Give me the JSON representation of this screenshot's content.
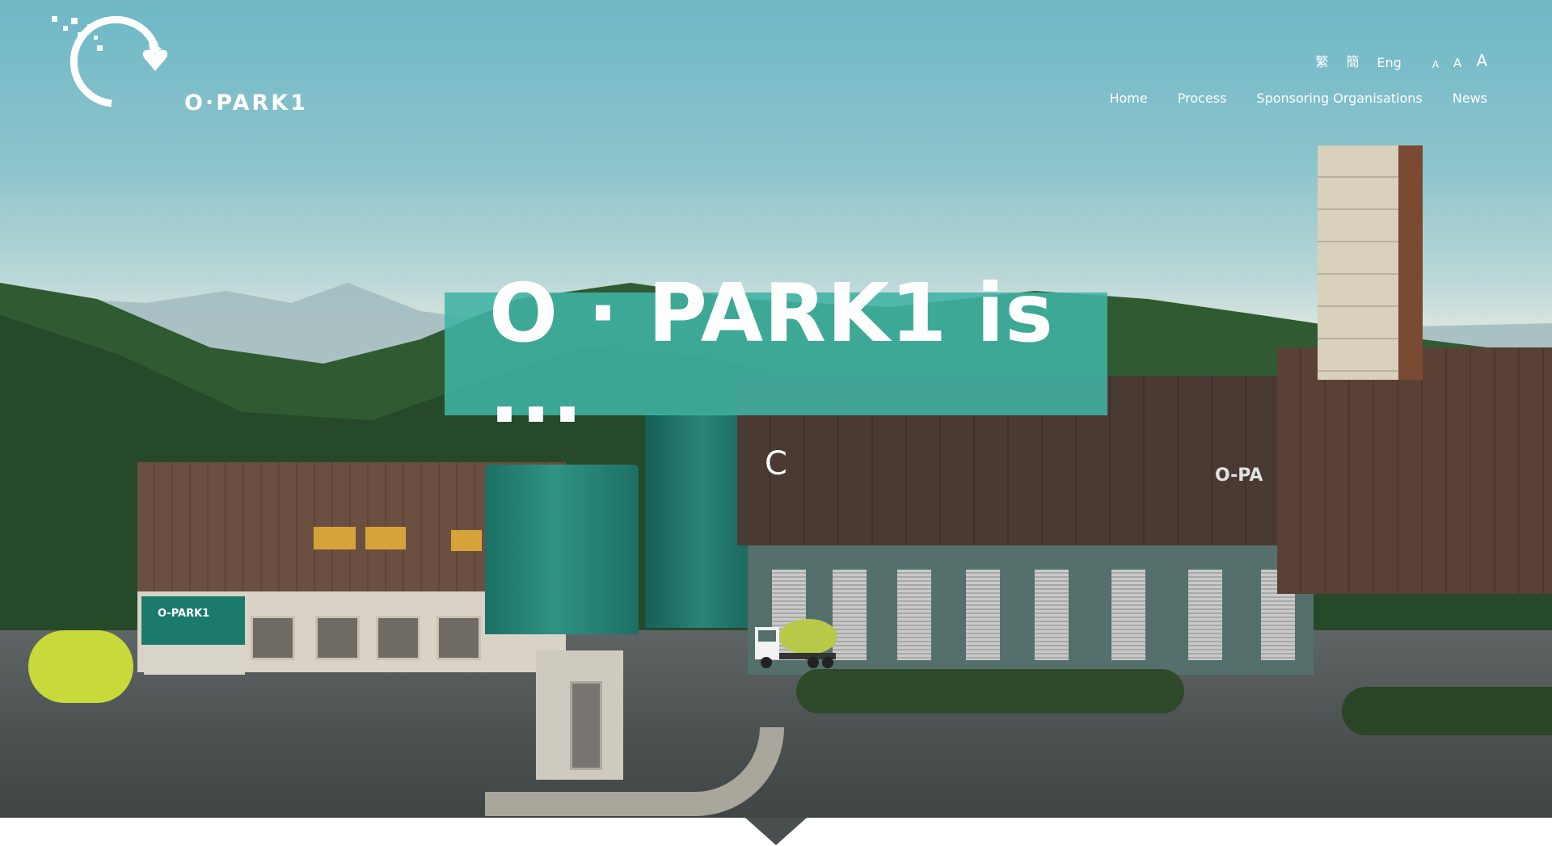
{
  "header": {
    "logo_text": "O·PARK1",
    "languages": [
      "繁",
      "簡",
      "Eng"
    ],
    "font_sizes": [
      "A",
      "A",
      "A"
    ],
    "nav": [
      "Home",
      "Process",
      "Sponsoring Organisations",
      "News"
    ]
  },
  "hero": {
    "headline": "O · PARK1 is ...",
    "typed_text": "C",
    "building_logo": "O-PA",
    "guard_logo": "O-PARK1"
  },
  "colors": {
    "accent": "#40b3a4",
    "white": "#ffffff"
  },
  "icons": {
    "scroll": "chevron-down-icon"
  }
}
